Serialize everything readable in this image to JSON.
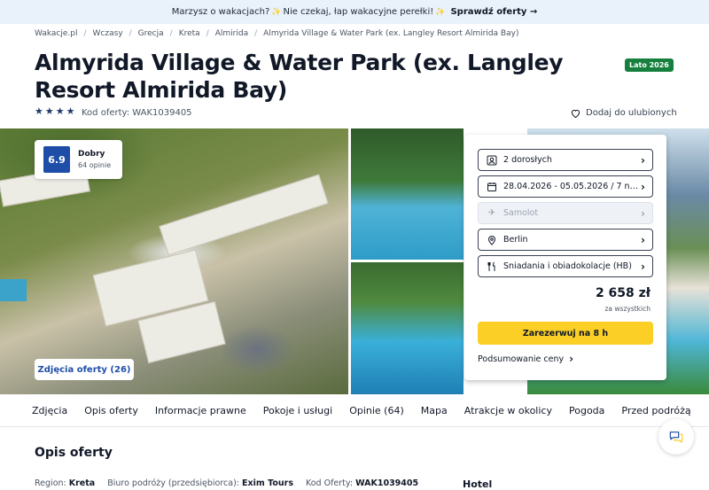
{
  "promo": {
    "text1": "Marzysz o wakacjach?",
    "emoji1": "✨",
    "text2": " Nie czekaj, łap wakacyjne perełki!",
    "emoji2": "✨",
    "link": "Sprawdź oferty →"
  },
  "breadcrumb": [
    "Wakacje.pl",
    "Wczasy",
    "Grecja",
    "Kreta",
    "Almirida",
    "Almyrida Village & Water Park (ex. Langley Resort Almirida Bay)"
  ],
  "hotel": {
    "title": "Almyrida Village & Water Park (ex. Langley Resort Almirida Bay)",
    "badge": "Lato 2026",
    "stars": 4,
    "code_label": "Kod oferty: WAK1039405",
    "favorite": "Dodaj do ulubionych"
  },
  "rating": {
    "score": "6.9",
    "label": "Dobry",
    "opinions": "64 opinie"
  },
  "photos_button": "Zdjęcia oferty (26)",
  "booking": {
    "fields": [
      {
        "icon": "person-icon",
        "label": "2 dorosłych",
        "disabled": false
      },
      {
        "icon": "calendar-icon",
        "label": "28.04.2026 - 05.05.2026 / 7 no...",
        "disabled": false
      },
      {
        "icon": "plane-icon",
        "label": "Samolot",
        "disabled": true
      },
      {
        "icon": "location-icon",
        "label": "Berlin",
        "disabled": false
      },
      {
        "icon": "cutlery-icon",
        "label": "Śniadania i obiadokolacje (HB)",
        "disabled": false
      }
    ],
    "price": "2 658 zł",
    "price_note": "za wszystkich",
    "book_label": "Zarezerwuj na 8 h",
    "summary_label": "Podsumowanie ceny"
  },
  "tabs": [
    "Zdjęcia",
    "Opis oferty",
    "Informacje prawne",
    "Pokoje i usługi",
    "Opinie (64)",
    "Mapa",
    "Atrakcje w okolicy",
    "Pogoda",
    "Przed podróżą"
  ],
  "section": {
    "title": "Opis oferty",
    "region_label": "Region:",
    "region_value": "Kreta",
    "agency_label": "Biuro podróży (przedsiębiorca):",
    "agency_value": "Exim Tours",
    "code_label": "Kod Oferty:",
    "code_value": "WAK1039405",
    "hotel_heading": "Hotel"
  },
  "colors": {
    "accent": "#1f4ea8",
    "badge": "#15803d",
    "cta": "#fbcf26",
    "promo_bg": "#e9f1fb"
  }
}
